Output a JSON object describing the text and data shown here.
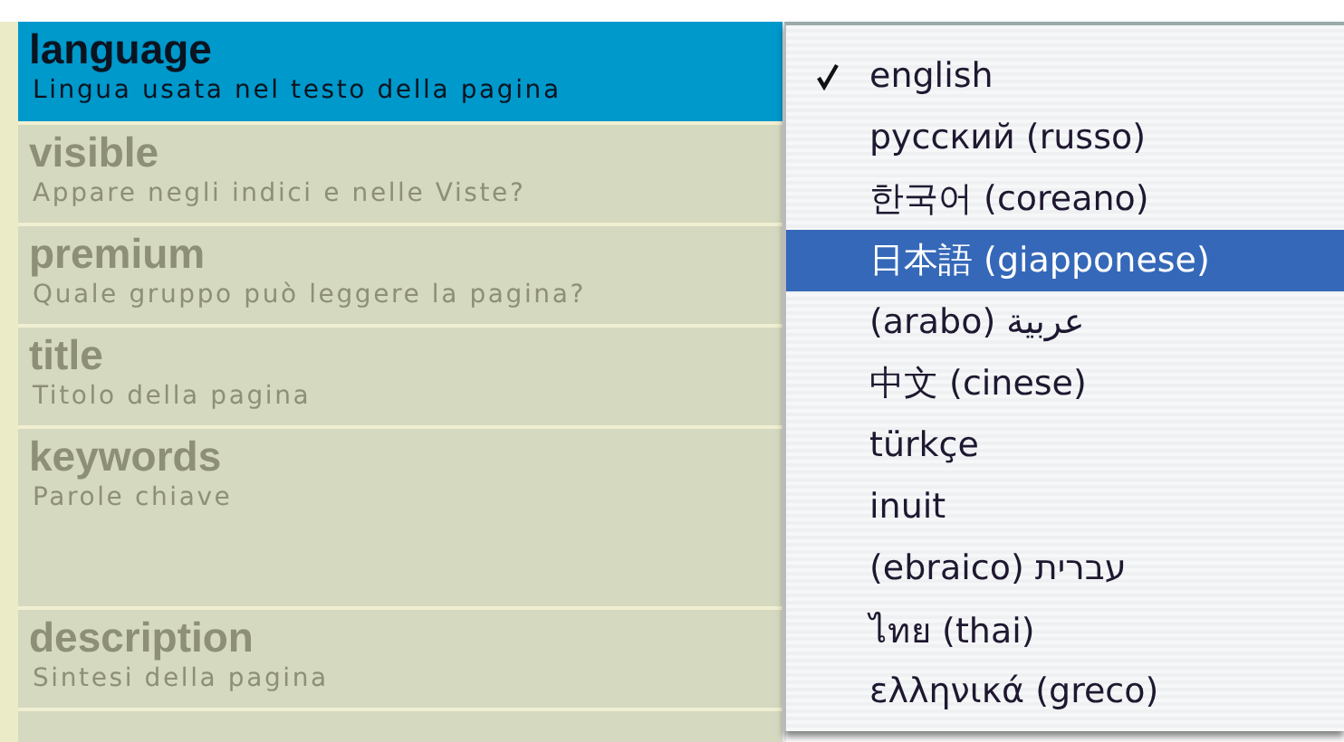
{
  "fields": [
    {
      "label": "language",
      "hint": "Lingua usata nel testo della pagina",
      "selected": true,
      "kind": "line"
    },
    {
      "label": "visible",
      "hint": "Appare negli indici e nelle Viste?",
      "selected": false,
      "kind": "line"
    },
    {
      "label": "premium",
      "hint": "Quale gruppo può leggere la pagina?",
      "selected": false,
      "kind": "line"
    },
    {
      "label": "title",
      "hint": "Titolo della pagina",
      "selected": false,
      "kind": "line"
    },
    {
      "label": "keywords",
      "hint": "Parole chiave",
      "selected": false,
      "kind": "textarea"
    },
    {
      "label": "description",
      "hint": "Sintesi della pagina",
      "selected": false,
      "kind": "line"
    }
  ],
  "language_menu": {
    "items": [
      {
        "label": "english",
        "checked": true,
        "selected": false
      },
      {
        "label": "русский (russo)",
        "checked": false,
        "selected": false
      },
      {
        "label": "한국어 (coreano)",
        "checked": false,
        "selected": false
      },
      {
        "label": "日本語 (giapponese)",
        "checked": false,
        "selected": true
      },
      {
        "label": "(arabo) عربية",
        "checked": false,
        "selected": false
      },
      {
        "label": "中文 (cinese)",
        "checked": false,
        "selected": false
      },
      {
        "label": "türkçe",
        "checked": false,
        "selected": false
      },
      {
        "label": "inuit",
        "checked": false,
        "selected": false
      },
      {
        "label": "(ebraico) עברית",
        "checked": false,
        "selected": false
      },
      {
        "label": "ไทย (thai)",
        "checked": false,
        "selected": false
      },
      {
        "label": "ελληνικά (greco)",
        "checked": false,
        "selected": false
      }
    ]
  }
}
